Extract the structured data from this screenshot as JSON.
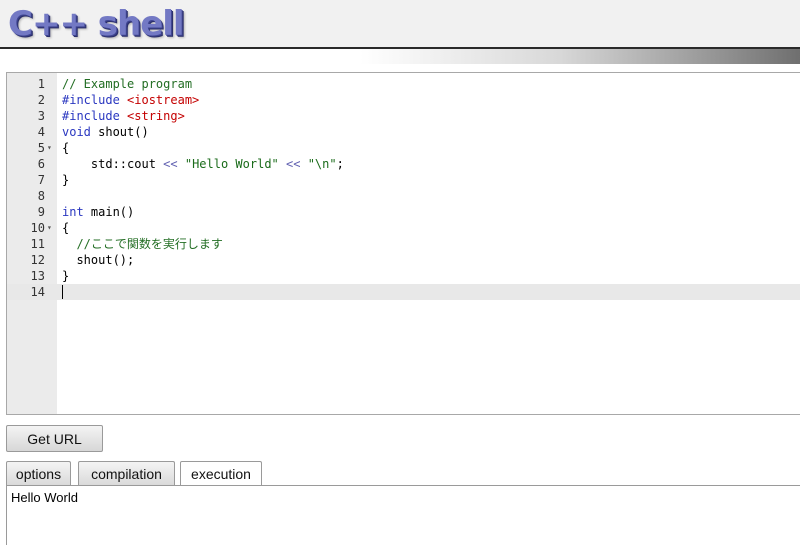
{
  "app": {
    "title": "C++ shell"
  },
  "editor": {
    "lines": [
      {
        "n": "1",
        "fold": "",
        "tokens": [
          {
            "t": "// Example program",
            "c": "t-comment"
          }
        ]
      },
      {
        "n": "2",
        "fold": "",
        "tokens": [
          {
            "t": "#include ",
            "c": "t-pre"
          },
          {
            "t": "<iostream>",
            "c": "t-inc"
          }
        ]
      },
      {
        "n": "3",
        "fold": "",
        "tokens": [
          {
            "t": "#include ",
            "c": "t-pre"
          },
          {
            "t": "<string>",
            "c": "t-inc"
          }
        ]
      },
      {
        "n": "4",
        "fold": "",
        "tokens": [
          {
            "t": "void",
            "c": "t-kw"
          },
          {
            "t": " shout()",
            "c": ""
          }
        ]
      },
      {
        "n": "5",
        "fold": "▾",
        "tokens": [
          {
            "t": "{",
            "c": ""
          }
        ]
      },
      {
        "n": "6",
        "fold": "",
        "tokens": [
          {
            "t": "    std::cout ",
            "c": ""
          },
          {
            "t": "<<",
            "c": "t-op"
          },
          {
            "t": " ",
            "c": ""
          },
          {
            "t": "\"Hello World\"",
            "c": "t-str"
          },
          {
            "t": " ",
            "c": ""
          },
          {
            "t": "<<",
            "c": "t-op"
          },
          {
            "t": " ",
            "c": ""
          },
          {
            "t": "\"\\n\"",
            "c": "t-str"
          },
          {
            "t": ";",
            "c": ""
          }
        ]
      },
      {
        "n": "7",
        "fold": "",
        "tokens": [
          {
            "t": "}",
            "c": ""
          }
        ]
      },
      {
        "n": "8",
        "fold": "",
        "tokens": []
      },
      {
        "n": "9",
        "fold": "",
        "tokens": [
          {
            "t": "int",
            "c": "t-kw"
          },
          {
            "t": " main()",
            "c": ""
          }
        ]
      },
      {
        "n": "10",
        "fold": "▾",
        "tokens": [
          {
            "t": "{",
            "c": ""
          }
        ]
      },
      {
        "n": "11",
        "fold": "",
        "tokens": [
          {
            "t": "  //ここで関数を実行します",
            "c": "t-comment"
          }
        ]
      },
      {
        "n": "12",
        "fold": "",
        "tokens": [
          {
            "t": "  shout();",
            "c": ""
          }
        ]
      },
      {
        "n": "13",
        "fold": "",
        "tokens": [
          {
            "t": "}",
            "c": ""
          }
        ]
      },
      {
        "n": "14",
        "fold": "",
        "tokens": [],
        "active": true
      }
    ]
  },
  "buttons": {
    "get_url": "Get URL"
  },
  "tabs": [
    {
      "label": "options"
    },
    {
      "label": "compilation"
    },
    {
      "label": "execution",
      "active": true
    }
  ],
  "output": {
    "text": "Hello World"
  },
  "colors": {
    "logo": "#7379c4",
    "comment": "#236e24",
    "preprocessor": "#2a37c0",
    "include": "#c40000",
    "string": "#1a6b1a",
    "gutter": "#ebebeb"
  }
}
